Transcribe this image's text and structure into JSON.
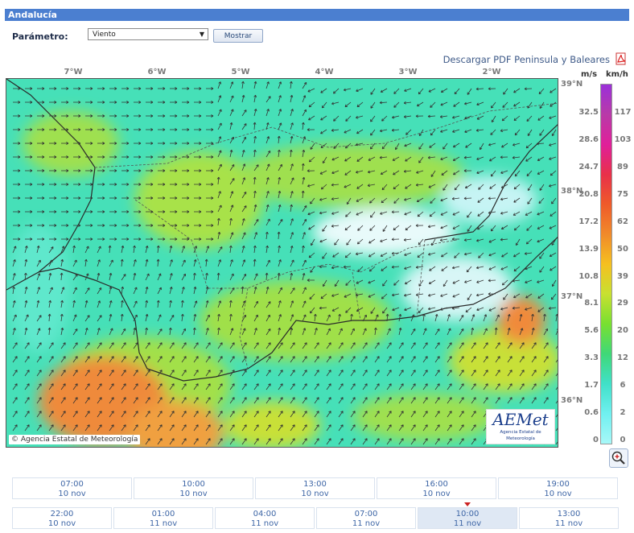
{
  "header": {
    "title": "Andalucía"
  },
  "form": {
    "param_label": "Parámetro:",
    "param_value": "Viento",
    "show_button": "Mostrar"
  },
  "pdf_link": "Descargar PDF Peninsula y Baleares",
  "lon_labels": [
    "7°W",
    "6°W",
    "5°W",
    "4°W",
    "3°W",
    "2°W"
  ],
  "lat_labels": [
    "39°N",
    "38°N",
    "37°N",
    "36°N"
  ],
  "map": {
    "copyright": "Agencia Estatal de Meteorología",
    "logo_text": "AEMet",
    "logo_sub": "Agencia Estatal de Meteorología"
  },
  "legend": {
    "unit_ms": "m/s",
    "unit_kmh": "km/h",
    "ms_values": [
      "32.5",
      "28.6",
      "24.7",
      "20.8",
      "17.2",
      "13.9",
      "10.8",
      "8.1",
      "5.6",
      "3.3",
      "1.7",
      "0.6",
      "0"
    ],
    "kmh_values": [
      "117",
      "103",
      "89",
      "75",
      "62",
      "50",
      "39",
      "29",
      "20",
      "12",
      "6",
      "2",
      "0"
    ],
    "colors": [
      "#9b30d9",
      "#b83aa8",
      "#e0209a",
      "#e8304a",
      "#ef5a2a",
      "#f08a2a",
      "#f5c020",
      "#c8e030",
      "#78e030",
      "#3fd878",
      "#40e0c8",
      "#70f0f0",
      "#a8f8f8"
    ]
  },
  "timeline": {
    "row1": [
      {
        "time": "07:00",
        "date": "10 nov"
      },
      {
        "time": "10:00",
        "date": "10 nov"
      },
      {
        "time": "13:00",
        "date": "10 nov"
      },
      {
        "time": "16:00",
        "date": "10 nov"
      },
      {
        "time": "19:00",
        "date": "10 nov"
      }
    ],
    "row2": [
      {
        "time": "22:00",
        "date": "10 nov"
      },
      {
        "time": "01:00",
        "date": "11 nov"
      },
      {
        "time": "04:00",
        "date": "11 nov"
      },
      {
        "time": "07:00",
        "date": "11 nov"
      },
      {
        "time": "10:00",
        "date": "11 nov"
      },
      {
        "time": "13:00",
        "date": "11 nov"
      }
    ],
    "active": "10:00 11 nov"
  }
}
